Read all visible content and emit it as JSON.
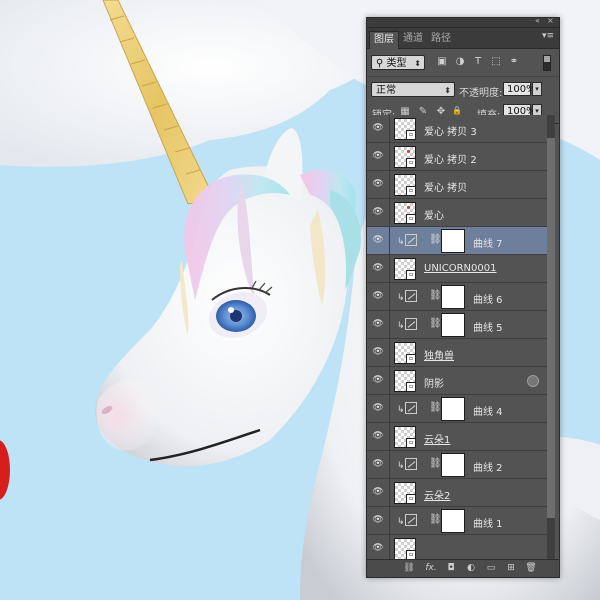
{
  "panel": {
    "topbar": {
      "collapse": "«",
      "close": "×"
    },
    "tabs": [
      {
        "label": "图层",
        "active": true
      },
      {
        "label": "通道",
        "active": false
      },
      {
        "label": "路径",
        "active": false
      }
    ],
    "menu_icon": "panel-menu-icon",
    "filter": {
      "kind_value": "类型",
      "icons": [
        "pixel-filter-icon",
        "adjustment-filter-icon",
        "type-filter-icon",
        "shape-filter-icon",
        "smart-object-filter-icon"
      ],
      "glyphs": [
        "▣",
        "◑",
        "T",
        "⬚",
        "⚭"
      ]
    },
    "blend": {
      "mode_value": "正常",
      "opacity_label": "不透明度:",
      "opacity_value": "100%"
    },
    "lock": {
      "label": "锁定:",
      "glyphs": [
        "▦",
        "✎",
        "✥",
        "🔒"
      ],
      "fill_label": "填充:",
      "fill_value": "100%"
    },
    "layers": [
      {
        "type": "pixel",
        "name": "爱心 拷贝 3",
        "dot": false,
        "underline": false,
        "selected": false
      },
      {
        "type": "pixel",
        "name": "爱心 拷贝 2",
        "dot": true,
        "underline": false,
        "selected": false
      },
      {
        "type": "pixel",
        "name": "爱心 拷贝",
        "dot": false,
        "underline": false,
        "selected": false
      },
      {
        "type": "pixel",
        "name": "爱心",
        "dot": true,
        "underline": false,
        "selected": false
      },
      {
        "type": "adjust",
        "name": "曲线 7",
        "selected": true
      },
      {
        "type": "pixel",
        "name": "UNICORN0001",
        "dot": false,
        "underline": true,
        "selected": false
      },
      {
        "type": "adjust",
        "name": "曲线 6",
        "selected": false
      },
      {
        "type": "adjust",
        "name": "曲线 5",
        "selected": false
      },
      {
        "type": "pixel",
        "name": "独角兽",
        "dot": false,
        "underline": true,
        "selected": false
      },
      {
        "type": "pixel",
        "name": "阴影",
        "dot": false,
        "underline": false,
        "selected": false,
        "fx": true
      },
      {
        "type": "adjust",
        "name": "曲线 4",
        "selected": false
      },
      {
        "type": "pixel",
        "name": "云朵1",
        "dot": false,
        "underline": true,
        "selected": false
      },
      {
        "type": "adjust",
        "name": "曲线 2",
        "selected": false
      },
      {
        "type": "pixel",
        "name": "云朵2",
        "dot": false,
        "underline": true,
        "selected": false
      },
      {
        "type": "adjust",
        "name": "曲线 1",
        "selected": false
      },
      {
        "type": "pixel",
        "name": "",
        "dot": false,
        "underline": false,
        "selected": false
      }
    ],
    "bottom_icons": [
      "link-layers-icon",
      "fx-icon",
      "add-mask-icon",
      "new-adjustment-icon",
      "new-group-icon",
      "new-layer-icon",
      "delete-layer-icon"
    ],
    "bottom_glyphs": [
      "⛓",
      "fx.",
      "◘",
      "◐",
      "▭",
      "⊞",
      "🗑"
    ]
  },
  "colors": {
    "sky": "#bfe3f6",
    "panel_bg": "#535353",
    "selected_row": "#6e7f9c"
  }
}
